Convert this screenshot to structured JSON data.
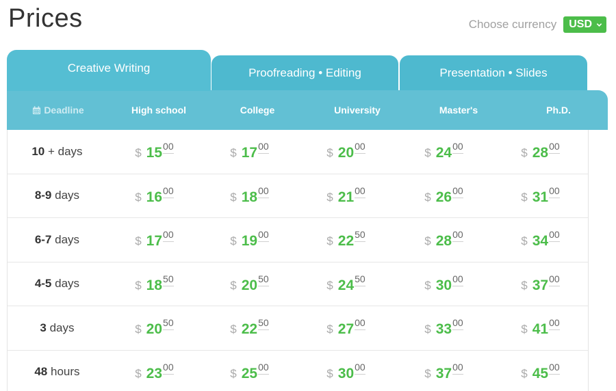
{
  "page_title": "Prices",
  "currency": {
    "label": "Choose currency",
    "selected": "USD",
    "icon": "chevron-down-icon"
  },
  "tabs": [
    {
      "label": "Creative Writing",
      "active": true
    },
    {
      "label": "Proofreading • Editing",
      "active": false
    },
    {
      "label": "Presentation • Slides",
      "active": false
    }
  ],
  "table": {
    "headers": [
      "Deadline",
      "High school",
      "College",
      "University",
      "Master's",
      "Ph.D."
    ],
    "currency_symbol": "$",
    "rows": [
      {
        "deadline_num": "10",
        "deadline_unit": "+ days",
        "prices": [
          [
            "15",
            "00"
          ],
          [
            "17",
            "00"
          ],
          [
            "20",
            "00"
          ],
          [
            "24",
            "00"
          ],
          [
            "28",
            "00"
          ]
        ]
      },
      {
        "deadline_num": "8-9",
        "deadline_unit": "days",
        "prices": [
          [
            "16",
            "00"
          ],
          [
            "18",
            "00"
          ],
          [
            "21",
            "00"
          ],
          [
            "26",
            "00"
          ],
          [
            "31",
            "00"
          ]
        ]
      },
      {
        "deadline_num": "6-7",
        "deadline_unit": "days",
        "prices": [
          [
            "17",
            "00"
          ],
          [
            "19",
            "00"
          ],
          [
            "22",
            "50"
          ],
          [
            "28",
            "00"
          ],
          [
            "34",
            "00"
          ]
        ]
      },
      {
        "deadline_num": "4-5",
        "deadline_unit": "days",
        "prices": [
          [
            "18",
            "50"
          ],
          [
            "20",
            "50"
          ],
          [
            "24",
            "50"
          ],
          [
            "30",
            "00"
          ],
          [
            "37",
            "00"
          ]
        ]
      },
      {
        "deadline_num": "3",
        "deadline_unit": "days",
        "prices": [
          [
            "20",
            "50"
          ],
          [
            "22",
            "50"
          ],
          [
            "27",
            "00"
          ],
          [
            "33",
            "00"
          ],
          [
            "41",
            "00"
          ]
        ]
      },
      {
        "deadline_num": "48",
        "deadline_unit": "hours",
        "prices": [
          [
            "23",
            "00"
          ],
          [
            "25",
            "00"
          ],
          [
            "30",
            "00"
          ],
          [
            "37",
            "00"
          ],
          [
            "45",
            "00"
          ]
        ]
      }
    ]
  },
  "colors": {
    "accent": "#4cbd4a",
    "tab": "#4eb9cf",
    "header": "#62c0d4"
  }
}
